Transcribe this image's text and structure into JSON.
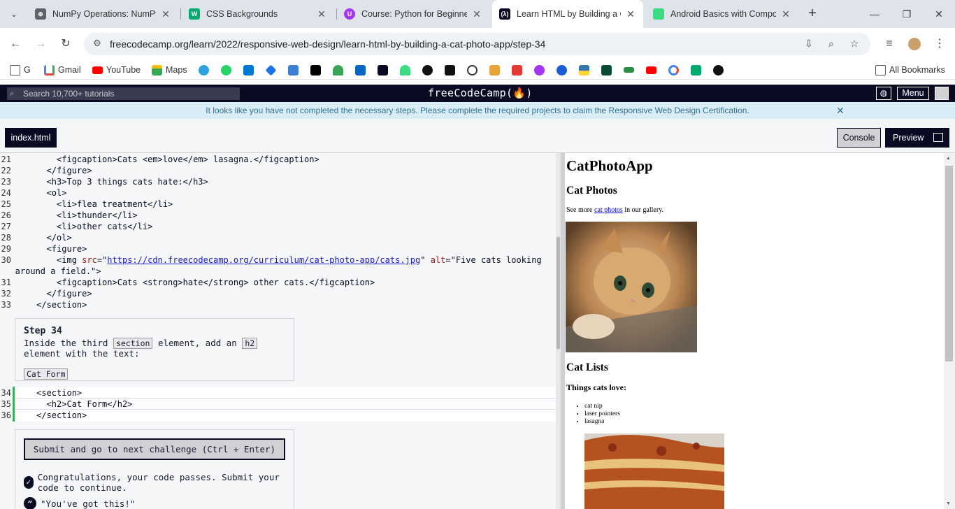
{
  "browser": {
    "tabs": [
      {
        "title": "NumPy Operations: NumPy",
        "favicon_color": "#5f6368"
      },
      {
        "title": "CSS Backgrounds",
        "favicon_color": "#04aa6d"
      },
      {
        "title": "Course: Python for Beginner",
        "favicon_color": "#a435f0"
      },
      {
        "title": "Learn HTML by Building a Ca",
        "favicon_color": "#0a0a23"
      },
      {
        "title": "Android Basics with Compos",
        "favicon_color": "#3ddc84"
      }
    ],
    "url": "freecodecamp.org/learn/2022/responsive-web-design/learn-html-by-building-a-cat-photo-app/step-34",
    "bookmarks": [
      "G",
      "Gmail",
      "YouTube",
      "Maps"
    ],
    "all_bookmarks": "All Bookmarks"
  },
  "fcc": {
    "search_placeholder": "Search 10,700+ tutorials",
    "logo": "freeCodeCamp(🔥)",
    "menu": "Menu",
    "notice": "It looks like you have not completed the necessary steps. Please complete the required projects to claim the Responsive Web Design Certification."
  },
  "toolbar": {
    "file_tab": "index.html",
    "console": "Console",
    "preview": "Preview"
  },
  "step": {
    "heading": "Step 34",
    "text_1": "Inside the third",
    "code_1": "section",
    "text_2": "element, add an",
    "code_2": "h2",
    "text_3": "element with the text:",
    "code_3": "Cat Form"
  },
  "actions": {
    "submit": "Submit and go to next challenge (Ctrl + Enter)",
    "pass_msg": "Congratulations, your code passes. Submit your code to continue.",
    "quote": "\"You've got this!\""
  },
  "preview": {
    "h1": "CatPhotoApp",
    "cat_photos": "Cat Photos",
    "see_more_1": "See more",
    "see_more_link": "cat photos",
    "see_more_2": "in our gallery.",
    "cat_lists": "Cat Lists",
    "things_love": "Things cats love:",
    "love_items": [
      "cat nip",
      "laser pointers",
      "lasagna"
    ]
  }
}
